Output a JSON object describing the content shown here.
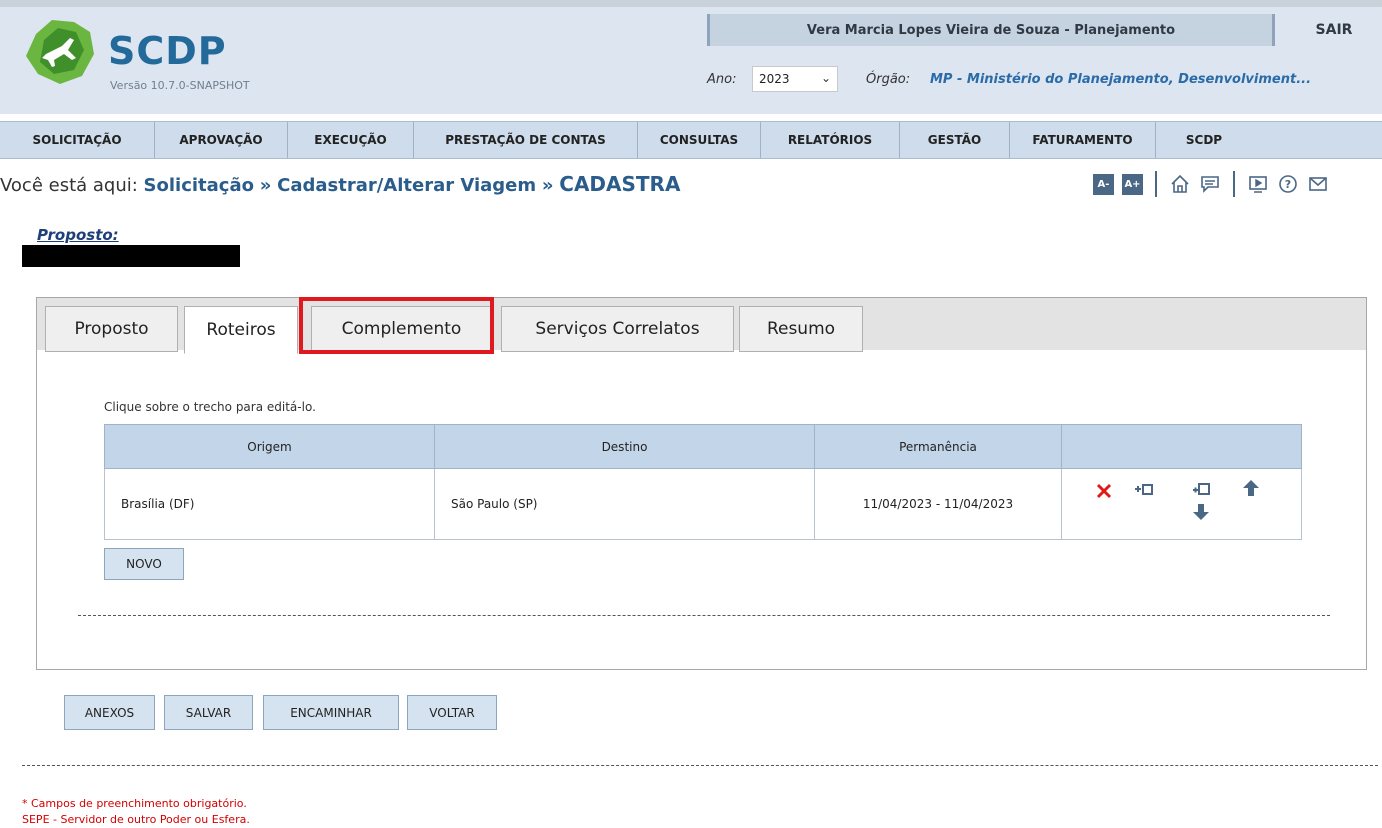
{
  "header": {
    "brand": "SCDP",
    "version": "Versão 10.7.0-SNAPSHOT",
    "user": "Vera Marcia Lopes Vieira de Souza - Planejamento",
    "logout": "SAIR",
    "year_label": "Ano:",
    "year_value": "2023",
    "org_label": "Órgão:",
    "org_value": "MP - Ministério do Planejamento, Desenvolviment..."
  },
  "nav": [
    {
      "label": "SOLICITAÇÃO"
    },
    {
      "label": "APROVAÇÃO"
    },
    {
      "label": "EXECUÇÃO"
    },
    {
      "label": "PRESTAÇÃO DE CONTAS"
    },
    {
      "label": "CONSULTAS"
    },
    {
      "label": "RELATÓRIOS"
    },
    {
      "label": "GESTÃO"
    },
    {
      "label": "FATURAMENTO"
    },
    {
      "label": "SCDP"
    }
  ],
  "breadcrumb": {
    "prefix": "Você está aqui:",
    "items": [
      "Solicitação",
      "Cadastrar/Alterar Viagem",
      "CADASTRA"
    ],
    "separator": "»"
  },
  "tools": {
    "font_down": "A-",
    "font_up": "A+",
    "icons": [
      "home-icon",
      "chat-icon",
      "screen-icon",
      "help-icon",
      "mail-icon"
    ]
  },
  "proposto": {
    "label": "Proposto:"
  },
  "tabs": [
    {
      "label": "Proposto"
    },
    {
      "label": "Roteiros",
      "active": true
    },
    {
      "label": "Complemento",
      "highlighted": true
    },
    {
      "label": "Serviços Correlatos"
    },
    {
      "label": "Resumo"
    }
  ],
  "hint": "Clique sobre o trecho para editá-lo.",
  "table": {
    "headers": [
      "Origem",
      "Destino",
      "Permanência",
      ""
    ],
    "rows": [
      {
        "origem": "Brasília (DF)",
        "destino": "São Paulo (SP)",
        "permanencia": "11/04/2023 - 11/04/2023"
      }
    ]
  },
  "buttons": {
    "novo": "NOVO",
    "anexos": "ANEXOS",
    "salvar": "SALVAR",
    "encaminhar": "ENCAMINHAR",
    "voltar": "VOLTAR"
  },
  "footer": {
    "required": "* Campos de preenchimento obrigatório.",
    "sepe": "SEPE - Servidor de outro Poder ou Esfera."
  },
  "colors": {
    "accent": "#2a5c8c",
    "highlight": "#e0191f",
    "header_bg": "#dde6f0",
    "nav_bg": "#cfdceb"
  }
}
